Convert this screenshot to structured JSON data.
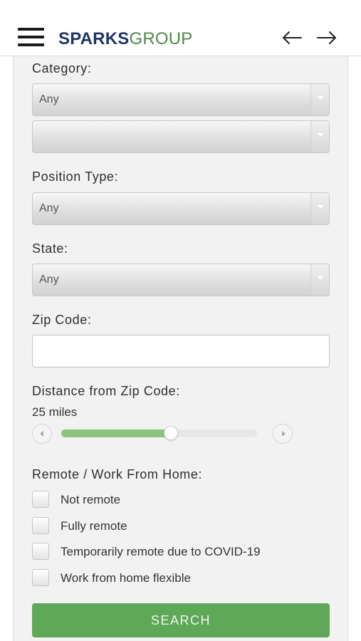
{
  "header": {
    "logo_part1": "SPARKS",
    "logo_part2": "GROUP",
    "menu_icon": "hamburger-menu-icon",
    "back_icon": "arrow-left-icon",
    "forward_icon": "arrow-right-icon"
  },
  "form": {
    "category": {
      "label": "Category:",
      "value": "Any",
      "subvalue": ""
    },
    "position_type": {
      "label": "Position Type:",
      "value": "Any"
    },
    "state": {
      "label": "State:",
      "value": "Any"
    },
    "zip_code": {
      "label": "Zip Code:",
      "value": "",
      "placeholder": ""
    },
    "distance": {
      "label": "Distance from Zip Code:",
      "value_text": "25 miles",
      "value": 25,
      "fill_fraction": 0.56
    },
    "remote": {
      "label": "Remote / Work From Home:",
      "options": [
        {
          "label": "Not remote",
          "checked": false
        },
        {
          "label": "Fully remote",
          "checked": false
        },
        {
          "label": "Temporarily remote due to COVID-19",
          "checked": false
        },
        {
          "label": "Work from home flexible",
          "checked": false
        }
      ]
    },
    "search_label": "SEARCH"
  },
  "colors": {
    "brand_navy": "#1f3468",
    "brand_green": "#4f8a45",
    "button_green": "#5ea858",
    "slider_fill": "#8cc47e"
  }
}
